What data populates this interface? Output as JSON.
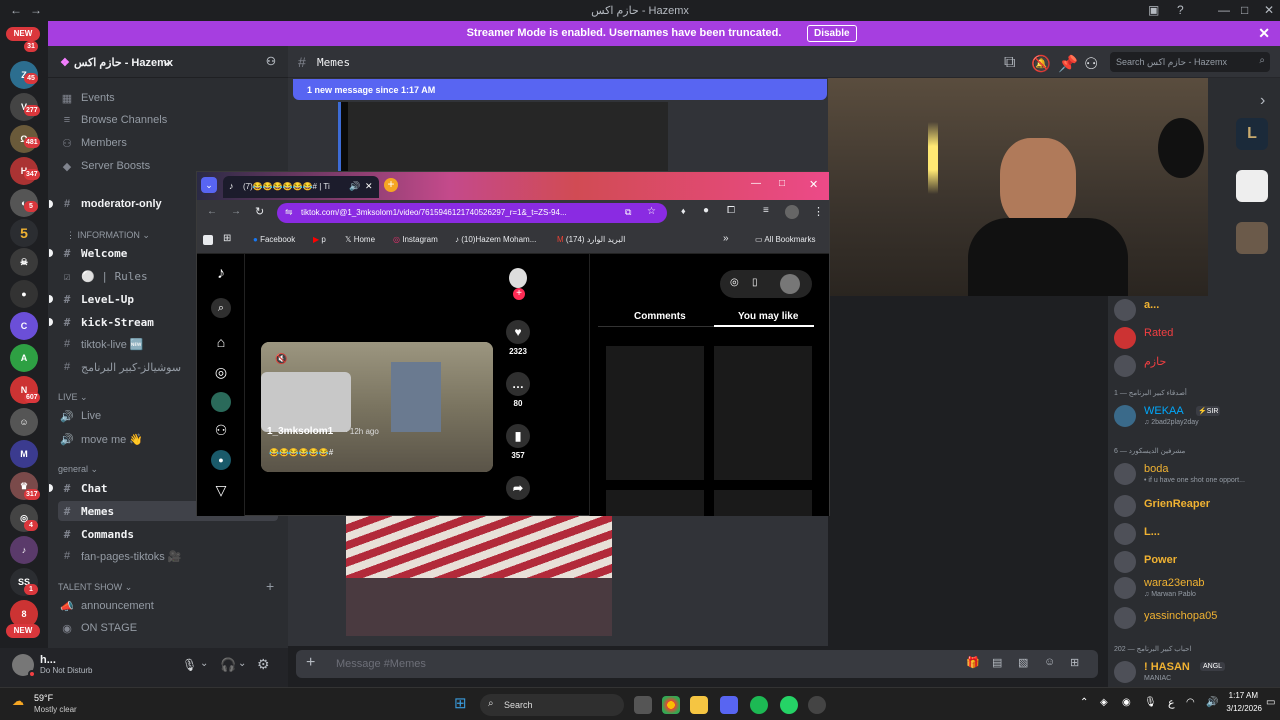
{
  "window": {
    "title": "حازم اكس - Hazemx"
  },
  "banner": {
    "text": "Streamer Mode is enabled. Usernames have been truncated.",
    "button": "Disable"
  },
  "rail": {
    "new_top": "NEW",
    "new_bottom": "NEW",
    "badges": [
      "31",
      "45",
      "277",
      "481",
      "347",
      "5",
      "607",
      "317",
      "4",
      "1"
    ]
  },
  "server": {
    "name": "حازم اكس - Hazemx"
  },
  "sidebar": {
    "top": [
      {
        "icon": "calendar-icon",
        "label": "Events"
      },
      {
        "icon": "browse-icon",
        "label": "Browse Channels"
      },
      {
        "icon": "members-icon",
        "label": "Members"
      },
      {
        "icon": "boost-icon",
        "label": "Server Boosts"
      }
    ],
    "moderator": "moderator-only",
    "cat_information": "Information",
    "info": [
      "Welcome",
      "⚪ | Rules",
      "LeveL-Up",
      "kick-Stream",
      "tiktok-live 🆕",
      "سوشيالز-كبير البرنامج"
    ],
    "cat_live": "LIVE",
    "live": [
      "Live",
      "move me 👋"
    ],
    "cat_general": "general",
    "general": [
      "Chat",
      "Memes",
      "Commands",
      "fan-pages-tiktoks 🎥"
    ],
    "cat_talent": "TALENT SHOW",
    "talent": [
      "announcement",
      "ON STAGE"
    ]
  },
  "user": {
    "name": "h...",
    "status": "Do Not Disturb"
  },
  "chat": {
    "channel": "Memes",
    "new_messages": "1 new message since 1:17 AM",
    "placeholder": "Message #Memes",
    "search": "Search حازم اكس - Hazemx"
  },
  "browser": {
    "tab_title": "(7)😂😂😂😂😂😂# | Ti",
    "url": "tiktok.com/@1_3mksolom1/video/7615946121740526297_r=1&_t=ZS-94...",
    "bookmarks": [
      "Facebook",
      "p",
      "Home",
      "Instagram",
      "(10)Hazem Moham...",
      "(174)",
      "البريد الوارد"
    ],
    "all_bookmarks": "All Bookmarks",
    "video_user": "1_3mksolom1",
    "video_time": "12h ago",
    "caption": "😂😂😂😂😂😂#",
    "likes": "2323",
    "comments": "80",
    "saves": "357",
    "tab_comments": "Comments",
    "tab_may_like": "You may like"
  },
  "members": {
    "items": [
      {
        "name": "a...",
        "color": "#f0b232",
        "status": ""
      },
      {
        "name": "Rated",
        "color": "#f23f42",
        "status": ""
      },
      {
        "name": "حازم",
        "color": "#f23f42",
        "status": ""
      }
    ],
    "cat1": "أصدقاء كبير البرنامج — 1",
    "group1": [
      {
        "name": "WEKAA",
        "color": "#00a8fc",
        "tag": "⚡SIR",
        "status": "♫ 2bad2play2day"
      }
    ],
    "cat2": "مشرفين الديسكورد — 6",
    "group2": [
      {
        "name": "boda",
        "color": "#f0b232",
        "status": "• if u have one shot one opport..."
      },
      {
        "name": "GrienReaper",
        "color": "#f0b232",
        "status": ""
      },
      {
        "name": "L...",
        "color": "#f0b232",
        "status": ""
      },
      {
        "name": "Power",
        "color": "#f0b232",
        "status": ""
      },
      {
        "name": "wara23enab",
        "color": "#f0b232",
        "status": "♫ Marwan Pablo"
      },
      {
        "name": "yassinchopa05",
        "color": "#f0b232",
        "status": ""
      }
    ],
    "cat3": "احباب كبير البرنامج — 202",
    "group3": [
      {
        "name": "! HASAN",
        "color": "#f0b232",
        "tag": "ANGL",
        "status": "MANIAC"
      }
    ]
  },
  "taskbar": {
    "weather": "59°F",
    "weather_desc": "Mostly clear",
    "search": "Search",
    "time": "1:17 AM",
    "date": "3/12/2026",
    "lang": "ع"
  }
}
